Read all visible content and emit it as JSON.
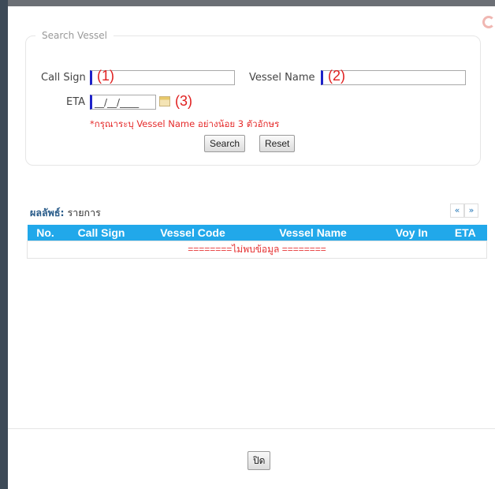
{
  "search": {
    "legend": "Search Vessel",
    "call_sign_label": "Call Sign",
    "vessel_name_label": "Vessel Name",
    "eta_label": "ETA",
    "eta_value": "__/__/____",
    "call_sign_value": "",
    "vessel_name_value": "",
    "annotations": [
      "(1)",
      "(2)",
      "(3)"
    ],
    "warning": "*กรุณาระบุ Vessel Name อย่างน้อย 3 ตัวอักษร",
    "search_button": "Search",
    "reset_button": "Reset"
  },
  "results": {
    "label_bold": "ผลลัพธ์:",
    "label_text": "รายการ",
    "pager_prev": "«",
    "pager_next": "»",
    "columns": [
      "No.",
      "Call Sign",
      "Vessel Code",
      "Vessel Name",
      "Voy In",
      "ETA"
    ],
    "empty_message": "========ไม่พบข้อมูล ========"
  },
  "footer": {
    "close_button": "ปิด"
  },
  "icons": {
    "calendar": "calendar-icon",
    "close": "close-icon"
  },
  "colors": {
    "header": "#21a8ea",
    "warning": "#e52b2b",
    "annotation": "#e02020"
  }
}
